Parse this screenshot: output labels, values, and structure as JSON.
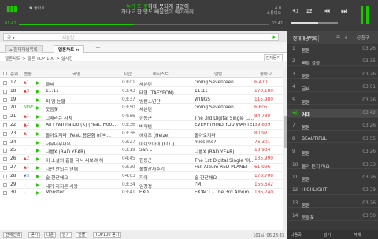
{
  "player": {
    "like_label": "좋아요",
    "lyric_line1_a": "누가 또 좋",
    "lyric_line1_b": "하대 못되게 굴었어",
    "lyric_line2": "하나도 한 명도 빼짐없이 얘기해줘",
    "time_elapsed": "01:42",
    "time_total": "03:42",
    "meta_top": "4.0",
    "meta_bottom": "스튜디오",
    "progress_fraction": 0.46
  },
  "search": {
    "kind_label": "곡",
    "placeholder": "세븐틴",
    "go_label": "▸"
  },
  "tabs": [
    {
      "label": "현재재생목록"
    },
    {
      "label": "멜론차트"
    }
  ],
  "breadcrumb": {
    "text": "멜론차트 > 멜론 TOP 100 > 실시간",
    "all_label": "전체듣기"
  },
  "table": {
    "headers": {
      "rank": "순위",
      "change": "변동",
      "title": "곡명",
      "time": "시간",
      "artist": "아티스트",
      "album": "앨범",
      "like": "좋아요"
    },
    "rows": [
      {
        "rank": "17",
        "change": "▲1",
        "dir": "up",
        "title": "글씨",
        "time": "03:01",
        "artist": "세븐틴",
        "album": "Going Seventeen",
        "like": "6,470"
      },
      {
        "rank": "18",
        "change": "▲3",
        "dir": "up",
        "title": "11:11",
        "time": "03:43",
        "artist": "태연 (TAEYEON)",
        "album": "11:11",
        "like": "170,180"
      },
      {
        "rank": "19",
        "change": "-",
        "dir": "eq",
        "title": "피 땀 눈물",
        "time": "03:37",
        "artist": "방탄소년단",
        "album": "WINGS",
        "like": "115,980"
      },
      {
        "rank": "20",
        "change": "NEW",
        "dir": "new",
        "title": "웃음꽃",
        "time": "03:50",
        "artist": "세븐틴",
        "album": "Going Seventeen",
        "like": "6,605"
      },
      {
        "rank": "21",
        "change": "▲1",
        "dir": "up",
        "title": "그때라는 사치",
        "time": "04:56",
        "artist": "한동근",
        "album": "The 3rd Digital Single '그...",
        "like": "84,780"
      },
      {
        "rank": "22",
        "change": "▲2",
        "dir": "up",
        "title": "All I Wanna Do (K) (Feat. Hoo...",
        "time": "03:36",
        "artist": "박재범",
        "album": "EVERYTHING YOU WANTED",
        "like": "39,839"
      },
      {
        "rank": "23",
        "change": "▲1",
        "dir": "up",
        "title": "돌아오지마 (Feat. 용준형 of 비...",
        "time": "03:36",
        "artist": "헤이즈 (Heize)",
        "album": "돌아오지마",
        "like": "80,921"
      },
      {
        "rank": "24",
        "change": "-",
        "dir": "eq",
        "title": "너무너무너무",
        "time": "03:27",
        "artist": "아이오아이 (I.O.I)",
        "album": "miss me?",
        "like": "76,301"
      },
      {
        "rank": "25",
        "change": "-",
        "dir": "eq",
        "title": "나쁜X (BAD YEAR)",
        "time": "03:19",
        "artist": "San E",
        "album": "나쁜X (BAD YEAR)",
        "like": "18,934"
      },
      {
        "rank": "26",
        "change": "▲2",
        "dir": "up",
        "title": "이 소설의 끝을 다시 써보려 해",
        "time": "04:45",
        "artist": "한동근",
        "album": "The 1st Digital Single '이...",
        "like": "135,990"
      },
      {
        "rank": "27",
        "change": "▲1",
        "dir": "up",
        "title": "나만 안되는 연애",
        "time": "03:39",
        "artist": "볼빨간사춘기",
        "album": "Full Album RED PLANET",
        "like": "61,996"
      },
      {
        "rank": "28",
        "change": "▼3",
        "dir": "dn",
        "title": "술 한잔해요",
        "time": "04:03",
        "artist": "지아",
        "album": "술 한잔해요",
        "like": "178,708"
      },
      {
        "rank": "29",
        "change": "-",
        "dir": "eq",
        "title": "내가 저지른 사랑",
        "time": "03:34",
        "artist": "임창정",
        "album": "I'M",
        "like": "156,642"
      },
      {
        "rank": "30",
        "change": "-",
        "dir": "eq",
        "title": "Monster",
        "time": "03:41",
        "artist": "EXO",
        "album": "EX'ACT - The 3rd Album",
        "like": "186,740"
      }
    ]
  },
  "bottom": {
    "buttons": [
      "전체선택",
      "듣기",
      "다운",
      "담기",
      "선물",
      "TOP100 듣기"
    ],
    "status": "101곡, 06:28:33"
  },
  "panel": {
    "tab_playlist": "현재재생목록",
    "tab_friend": "친구",
    "items": [
      {
        "n": "1",
        "title": "붐붐",
        "dur": "03:26"
      },
      {
        "n": "2",
        "title": "빠른 걸음",
        "dur": "03:35"
      },
      {
        "n": "3",
        "title": "붐붐",
        "dur": "03:26"
      },
      {
        "n": "4",
        "title": "글씨",
        "dur": "03:01"
      },
      {
        "n": "5",
        "title": "붐붐",
        "dur": "03:26"
      },
      {
        "n": "",
        "title": "거대",
        "dur": "03:42"
      },
      {
        "n": "7",
        "title": "붐붐",
        "dur": "03:26"
      },
      {
        "n": "8",
        "title": "BEAUTIFUL",
        "dur": "03:55"
      },
      {
        "n": "9",
        "title": "붐붐",
        "dur": "03:26"
      },
      {
        "n": "10",
        "title": "울리 듣지 마요",
        "dur": "03:33"
      },
      {
        "n": "11",
        "title": "붐붐",
        "dur": "03:26"
      },
      {
        "n": "12",
        "title": "HIGHLIGHT",
        "dur": "03:39"
      },
      {
        "n": "13",
        "title": "붐붐",
        "dur": "03:26"
      },
      {
        "n": "14",
        "title": "웃음꽃",
        "dur": "03:50"
      }
    ],
    "bottom_left": "다음곡",
    "bottom_mid": "담기",
    "bottom_right": "삭제"
  }
}
